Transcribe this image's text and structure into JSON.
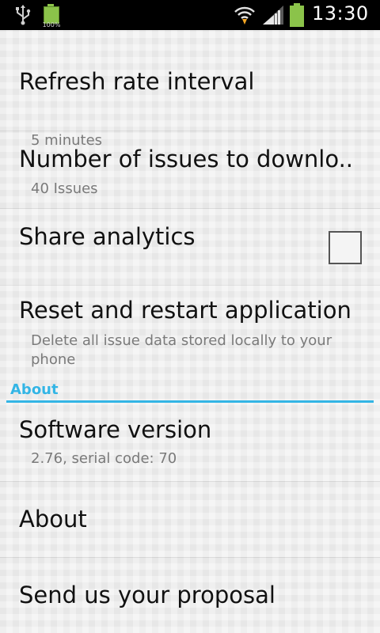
{
  "status_bar": {
    "battery_small_percent": "100%",
    "time": "13:30",
    "icons": [
      "usb-icon",
      "battery-icon",
      "wifi-icon",
      "signal-icon",
      "battery-icon"
    ]
  },
  "preferences": [
    {
      "title": "Refresh rate interval",
      "summary": "5 minutes"
    },
    {
      "title": "Number of issues to downlo..",
      "summary": "40 Issues"
    },
    {
      "title": "Share analytics",
      "checked": false
    },
    {
      "title": "Reset and restart application",
      "summary": "Delete all issue data stored locally to your phone"
    }
  ],
  "about_section": {
    "header": "About",
    "items": [
      {
        "title": "Software version",
        "summary": "2.76, serial code: 70"
      },
      {
        "title": "About"
      },
      {
        "title": "Send us your proposal"
      }
    ]
  },
  "colors": {
    "accent": "#33b5e5",
    "battery": "#8bc34a",
    "title_text": "#111111",
    "summary_text": "#7a7a7a"
  }
}
